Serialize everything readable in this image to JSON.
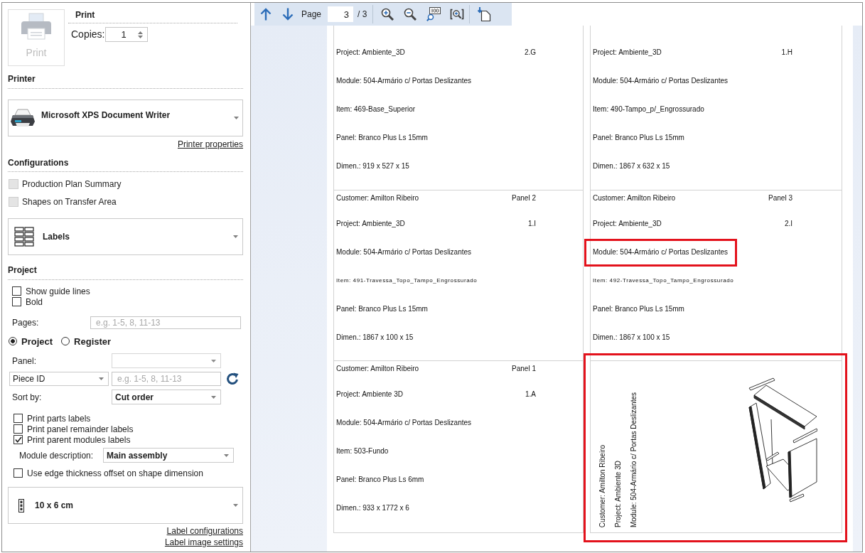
{
  "print_button": {
    "label": "Print",
    "disabled": true
  },
  "print_section": {
    "title": "Print",
    "copies_label": "Copies:",
    "copies": "1"
  },
  "printer": {
    "title": "Printer",
    "name": "Microsoft XPS Document Writer",
    "properties_link": "Printer properties"
  },
  "configurations": {
    "title": "Configurations",
    "options": [
      {
        "label": "Production Plan Summary",
        "checked": false,
        "disabled": true
      },
      {
        "label": "Shapes on Transfer Area",
        "checked": false,
        "disabled": true
      }
    ],
    "layout": "Labels"
  },
  "project": {
    "title": "Project",
    "options": [
      {
        "label": "Show guide lines",
        "checked": false
      },
      {
        "label": "Bold",
        "checked": false
      }
    ],
    "pages": {
      "label": "Pages:",
      "placeholder": "e.g. 1-5, 8, 11-13"
    },
    "modes": [
      {
        "label": "Project",
        "selected": true
      },
      {
        "label": "Register",
        "selected": false
      }
    ],
    "panel_label": "Panel:",
    "filter": {
      "field": "Piece ID",
      "placeholder": "e.g. 1-5, 8, 11-13"
    },
    "sort": {
      "label": "Sort by:",
      "value": "Cut order"
    },
    "print_options": [
      {
        "label": "Print parts labels",
        "checked": false
      },
      {
        "label": "Print panel remainder labels",
        "checked": false
      },
      {
        "label": "Print parent modules labels",
        "checked": true
      }
    ],
    "module_description": {
      "label": "Module description:",
      "value": "Main assembly"
    },
    "edge_option": {
      "label": "Use edge thickness offset on shape dimension",
      "checked": false
    },
    "label_size": "10 x 6 cm",
    "links": [
      "Label configurations",
      "Label image settings"
    ]
  },
  "toolbar": {
    "page_label": "Page",
    "page": "3",
    "page_count": "/ 3"
  },
  "labels": [
    {
      "kind": "part",
      "highlighted": false,
      "module_highlighted": false,
      "project": "Project: Ambiente_3D",
      "code": "2.G",
      "module": "Module: 504-Armário c/ Portas Deslizantes",
      "item": "Item: 469-Base_Superior",
      "small_item": false,
      "material": "Panel: Branco Plus Ls 15mm",
      "dimensions": "Dimen.: 919 x 527 x 15"
    },
    {
      "kind": "part",
      "highlighted": false,
      "module_highlighted": false,
      "project": "Project: Ambiente_3D",
      "code": "1.H",
      "module": "Module: 504-Armário c/ Portas Deslizantes",
      "item": "Item: 490-Tampo_p/_Engrossurado",
      "small_item": false,
      "material": "Panel: Branco Plus Ls 15mm",
      "dimensions": "Dimen.: 1867 x 632 x 15"
    },
    {
      "kind": "part",
      "highlighted": false,
      "module_highlighted": false,
      "customer": "Customer: Amilton Ribeiro",
      "panel_number": "Panel 2",
      "project": "Project: Ambiente_3D",
      "code": "1.I",
      "module": "Module: 504-Armário c/ Portas Deslizantes",
      "item": "Item: 491-Travessa_Topo_Tampo_Engrossurado",
      "small_item": true,
      "material": "Panel: Branco Plus Ls 15mm",
      "dimensions": "Dimen.: 1867 x 100 x 15"
    },
    {
      "kind": "part",
      "highlighted": false,
      "module_highlighted": true,
      "customer": "Customer: Amilton Ribeiro",
      "panel_number": "Panel 3",
      "project": "Project: Ambiente_3D",
      "code": "2.I",
      "module": "Module: 504-Armário c/ Portas Deslizantes",
      "item": "Item: 492-Travessa_Topo_Tampo_Engrossurado",
      "small_item": true,
      "material": "Panel: Branco Plus Ls 15mm",
      "dimensions": "Dimen.: 1867 x 100 x 15"
    },
    {
      "kind": "part",
      "highlighted": false,
      "module_highlighted": false,
      "customer": "Customer: Amilton Ribeiro",
      "panel_number": "Panel 1",
      "project": "Project: Ambiente 3D",
      "code": "1.A",
      "module": "Module: 504-Armário c/ Portas Deslizantes",
      "item": "Item: 503-Fundo",
      "small_item": false,
      "material": "Panel: Branco Plus Ls 6mm",
      "dimensions": "Dimen.: 933 x 1772 x 6"
    },
    {
      "kind": "module",
      "highlighted": true,
      "lines": [
        "Customer: Amilton Ribeiro",
        "Project: Ambiente 3D",
        "Module: 504-Armário c/ Portas Deslizantes"
      ]
    }
  ]
}
